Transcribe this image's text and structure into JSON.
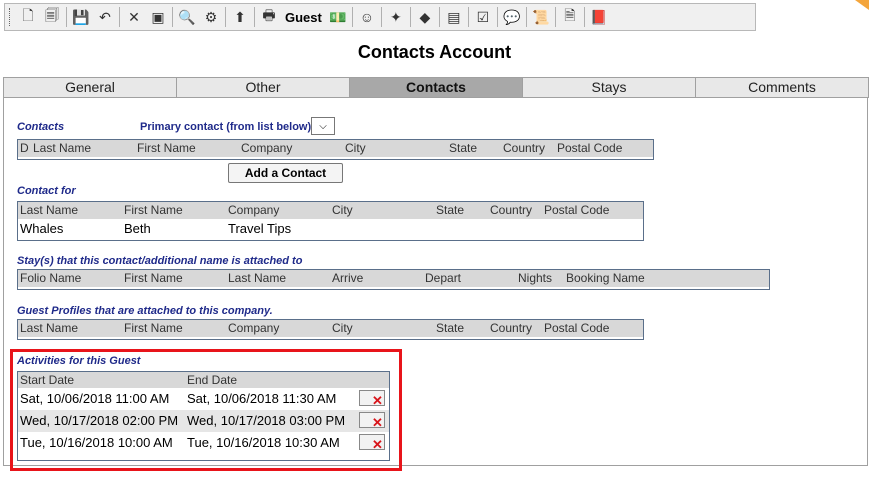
{
  "toolbar": {
    "icons": [
      {
        "name": "new-document-icon",
        "glyph": "🗋"
      },
      {
        "name": "copy-document-icon",
        "glyph": "🗐"
      },
      {
        "name": "save-icon",
        "glyph": "💾"
      },
      {
        "name": "undo-icon",
        "glyph": "↶"
      },
      {
        "name": "delete-icon",
        "glyph": "✕"
      },
      {
        "name": "card-icon",
        "glyph": "▣"
      },
      {
        "name": "search-icon",
        "glyph": "🔍"
      },
      {
        "name": "tools-icon",
        "glyph": "⚙"
      },
      {
        "name": "upload-icon",
        "glyph": "⬆"
      },
      {
        "name": "print-icon",
        "glyph": "🖶"
      }
    ],
    "guest_label": "Guest",
    "icons_after": [
      {
        "name": "money-icon",
        "glyph": "💵"
      },
      {
        "name": "smiley-icon",
        "glyph": "☺"
      },
      {
        "name": "magic-wand-icon",
        "glyph": "✦"
      },
      {
        "name": "tag-icon",
        "glyph": "◆"
      },
      {
        "name": "stamp-icon",
        "glyph": "▤"
      },
      {
        "name": "checklist-icon",
        "glyph": "☑"
      },
      {
        "name": "speech-bubble-icon",
        "glyph": "💬"
      },
      {
        "name": "scroll-icon",
        "glyph": "📜"
      },
      {
        "name": "documents-icon",
        "glyph": "🗎"
      },
      {
        "name": "book-icon",
        "glyph": "📕"
      }
    ]
  },
  "page_title": "Contacts Account",
  "tabs": [
    {
      "label": "General",
      "active": false
    },
    {
      "label": "Other",
      "active": false
    },
    {
      "label": "Contacts",
      "active": true
    },
    {
      "label": "Stays",
      "active": false
    },
    {
      "label": "Comments",
      "active": false
    }
  ],
  "contacts": {
    "label": "Contacts",
    "primary_label": "Primary contact (from list below)",
    "columns": [
      "D",
      "Last Name",
      "First Name",
      "Company",
      "City",
      "State",
      "Country",
      "Postal Code"
    ],
    "add_button": "Add a Contact"
  },
  "contact_for": {
    "label": "Contact for",
    "columns": [
      "Last Name",
      "First Name",
      "Company",
      "City",
      "State",
      "Country",
      "Postal Code"
    ],
    "rows": [
      [
        "Whales",
        "Beth",
        "Travel Tips",
        "",
        "",
        "",
        ""
      ]
    ]
  },
  "stays": {
    "label": "Stay(s) that this contact/additional name is attached to",
    "columns": [
      "Folio Name",
      "First Name",
      "Last Name",
      "Arrive",
      "Depart",
      "Nights",
      "Booking Name"
    ]
  },
  "guest_profiles": {
    "label": "Guest Profiles that are attached to this company.",
    "columns": [
      "Last Name",
      "First Name",
      "Company",
      "City",
      "State",
      "Country",
      "Postal Code"
    ]
  },
  "activities": {
    "label": "Activities for this Guest",
    "columns": [
      "Start Date",
      "End Date"
    ],
    "rows": [
      [
        "Sat, 10/06/2018 11:00 AM",
        "Sat, 10/06/2018 11:30 AM"
      ],
      [
        "Wed, 10/17/2018 02:00 PM",
        "Wed, 10/17/2018 03:00 PM"
      ],
      [
        "Tue, 10/16/2018 10:00 AM",
        "Tue, 10/16/2018 10:30 AM"
      ]
    ],
    "delete_glyph": "✕"
  },
  "colors": {
    "highlight": "#e8141a",
    "section_label": "#1f2a8a",
    "active_tab": "#a8a8a8"
  }
}
